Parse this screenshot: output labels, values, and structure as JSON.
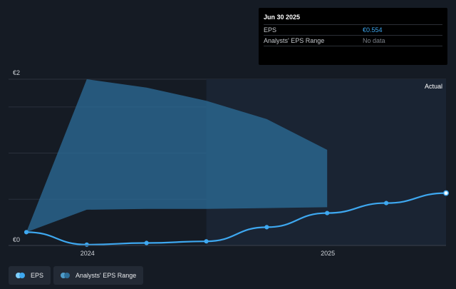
{
  "tooltip": {
    "title": "Jun 30 2025",
    "rows": [
      {
        "label": "EPS",
        "value": "€0.554"
      },
      {
        "label": "Analysts' EPS Range",
        "value": "No data"
      }
    ]
  },
  "legend": {
    "items": [
      {
        "label": "EPS",
        "color": "#3ea8f0"
      },
      {
        "label": "Analysts' EPS Range",
        "color": "#2d6e99"
      }
    ]
  },
  "chart_data": {
    "type": "line",
    "title": "",
    "xlabel": "",
    "ylabel": "",
    "y_tick_labels": [
      "€2",
      "€0"
    ],
    "yticks": [
      2,
      0
    ],
    "ylim": [
      0,
      2
    ],
    "xlim": [
      "2023-09-30",
      "2025-06-30"
    ],
    "x_tick_labels": [
      "2024",
      "2025"
    ],
    "xticks": [
      "2024-01-01",
      "2025-01-01"
    ],
    "actual_label": "Actual",
    "actual_from": "2024-06-30",
    "grid": true,
    "colors": {
      "eps": "#3ea8f0",
      "range": "#2d6e99"
    },
    "series": [
      {
        "name": "EPS",
        "type": "line",
        "x": [
          "2023-09-30",
          "2023-12-31",
          "2024-03-31",
          "2024-06-30",
          "2024-09-30",
          "2024-12-31",
          "2025-03-31",
          "2025-06-30"
        ],
        "y": [
          0.16,
          0.01,
          0.03,
          0.05,
          0.22,
          0.39,
          0.51,
          0.63
        ]
      },
      {
        "name": "Analysts' EPS Range",
        "type": "area",
        "x": [
          "2023-09-30",
          "2023-12-31",
          "2024-03-31",
          "2024-06-30",
          "2024-09-30",
          "2024-12-31"
        ],
        "low": [
          0.16,
          0.43,
          0.44,
          0.44,
          0.45,
          0.46
        ],
        "high": [
          0.16,
          2.0,
          1.9,
          1.74,
          1.52,
          1.15
        ]
      }
    ]
  }
}
